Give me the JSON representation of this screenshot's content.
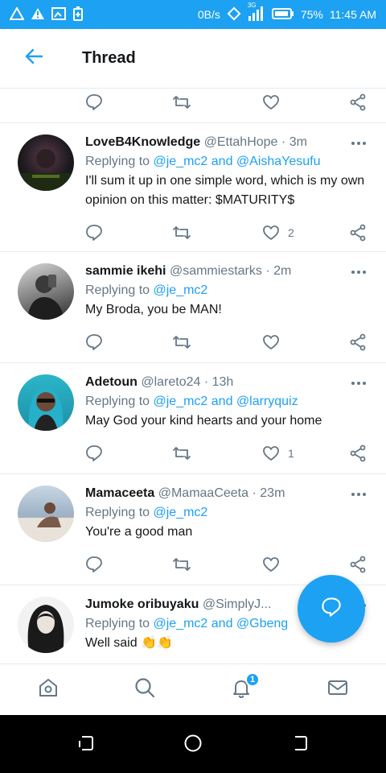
{
  "status_bar": {
    "net_speed": "0B/s",
    "network_type": "3G",
    "battery": "75%",
    "time": "11:45 AM"
  },
  "header": {
    "title": "Thread"
  },
  "tweets": [
    {
      "name": "LoveB4Knowledge",
      "handle": "@EttahHope",
      "time": "3m",
      "replying_label": "Replying to",
      "replying_to": "@je_mc2 and @AishaYesufu",
      "text": "I'll sum it up in one simple word, which is my own opinion on this matter: $MATURITY$",
      "likes": "2"
    },
    {
      "name": "sammie ikehi",
      "handle": "@sammiestarks",
      "time": "2m",
      "replying_label": "Replying to",
      "replying_to": "@je_mc2",
      "text": "My Broda, you be MAN!",
      "likes": ""
    },
    {
      "name": "Adetoun",
      "handle": "@lareto24",
      "time": "13h",
      "replying_label": "Replying to",
      "replying_to": "@je_mc2 and @larryquiz",
      "text": "May God your kind hearts and your home",
      "likes": "1"
    },
    {
      "name": "Mamaceeta",
      "handle": "@MamaaCeeta",
      "time": "23m",
      "replying_label": "Replying to",
      "replying_to": "@je_mc2",
      "text": "You're a good man",
      "likes": ""
    },
    {
      "name": "Jumoke oribuyaku",
      "handle": "@SimplyJ...",
      "time": "",
      "replying_label": "Replying to",
      "replying_to": "@je_mc2 and @Gbeng",
      "text": "Well said 👏👏",
      "likes": ""
    }
  ],
  "bottom_nav": {
    "notification_count": "1"
  },
  "colors": {
    "accent": "#1da1f2",
    "muted": "#657786",
    "border": "#e6ecf0"
  }
}
